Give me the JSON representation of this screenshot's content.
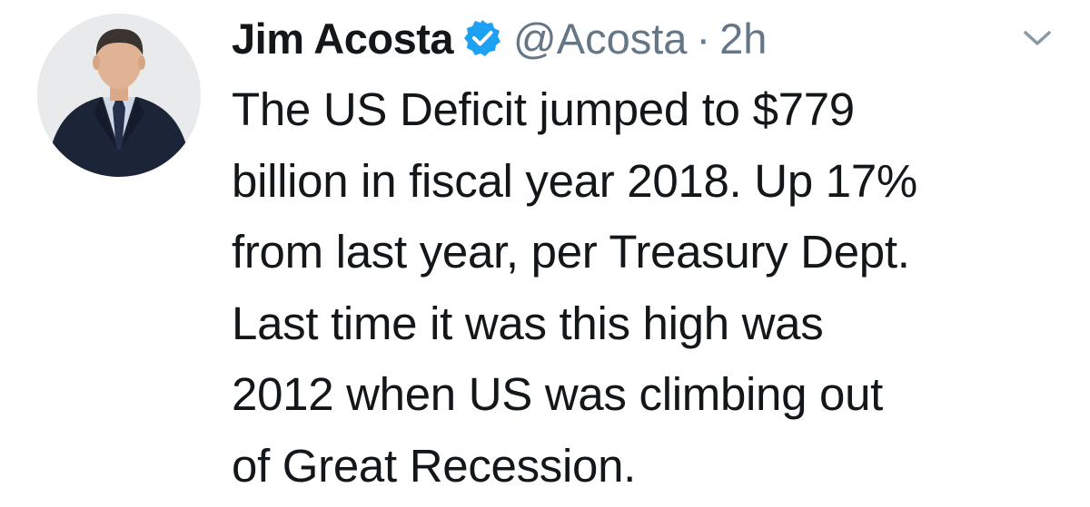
{
  "tweet": {
    "author": {
      "display_name": "Jim Acosta",
      "handle": "@Acosta",
      "verified": true,
      "avatar_icon": "profile-photo"
    },
    "separator": "·",
    "timestamp": "2h",
    "menu_icon": "chevron-down-icon",
    "text_lines": [
      "The US Deficit jumped to $779",
      "billion in fiscal year 2018. Up 17%",
      "from last year, per Treasury Dept.",
      "Last time it was this high was",
      "2012 when US was climbing out",
      "of Great Recession."
    ]
  },
  "colors": {
    "name": "#14171a",
    "secondary": "#657786",
    "verified_badge": "#1da1f2",
    "chevron": "#8899a6"
  }
}
